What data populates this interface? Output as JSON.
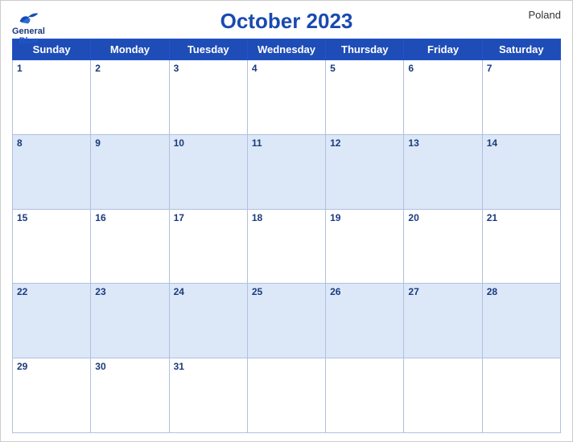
{
  "header": {
    "title": "October 2023",
    "country": "Poland",
    "logo": {
      "line1": "General",
      "line2": "Blue"
    }
  },
  "days_of_week": [
    "Sunday",
    "Monday",
    "Tuesday",
    "Wednesday",
    "Thursday",
    "Friday",
    "Saturday"
  ],
  "weeks": [
    [
      {
        "day": 1,
        "empty": false
      },
      {
        "day": 2,
        "empty": false
      },
      {
        "day": 3,
        "empty": false
      },
      {
        "day": 4,
        "empty": false
      },
      {
        "day": 5,
        "empty": false
      },
      {
        "day": 6,
        "empty": false
      },
      {
        "day": 7,
        "empty": false
      }
    ],
    [
      {
        "day": 8,
        "empty": false
      },
      {
        "day": 9,
        "empty": false
      },
      {
        "day": 10,
        "empty": false
      },
      {
        "day": 11,
        "empty": false
      },
      {
        "day": 12,
        "empty": false
      },
      {
        "day": 13,
        "empty": false
      },
      {
        "day": 14,
        "empty": false
      }
    ],
    [
      {
        "day": 15,
        "empty": false
      },
      {
        "day": 16,
        "empty": false
      },
      {
        "day": 17,
        "empty": false
      },
      {
        "day": 18,
        "empty": false
      },
      {
        "day": 19,
        "empty": false
      },
      {
        "day": 20,
        "empty": false
      },
      {
        "day": 21,
        "empty": false
      }
    ],
    [
      {
        "day": 22,
        "empty": false
      },
      {
        "day": 23,
        "empty": false
      },
      {
        "day": 24,
        "empty": false
      },
      {
        "day": 25,
        "empty": false
      },
      {
        "day": 26,
        "empty": false
      },
      {
        "day": 27,
        "empty": false
      },
      {
        "day": 28,
        "empty": false
      }
    ],
    [
      {
        "day": 29,
        "empty": false
      },
      {
        "day": 30,
        "empty": false
      },
      {
        "day": 31,
        "empty": false
      },
      {
        "day": null,
        "empty": true
      },
      {
        "day": null,
        "empty": true
      },
      {
        "day": null,
        "empty": true
      },
      {
        "day": null,
        "empty": true
      }
    ]
  ]
}
